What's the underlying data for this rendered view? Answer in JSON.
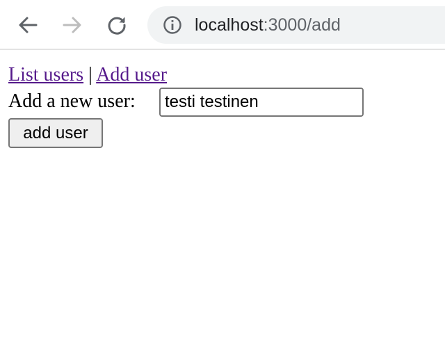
{
  "browser": {
    "url_host": "localhost",
    "url_rest": ":3000/add",
    "icons": {
      "back": "arrow-left-icon",
      "forward": "arrow-right-icon",
      "reload": "reload-icon",
      "site_info": "info-icon"
    },
    "colors": {
      "toolbar_bg": "#ffffff",
      "omnibox_bg": "#f1f3f4",
      "icon_active": "#5f6368",
      "icon_disabled": "#bdbdbd"
    }
  },
  "page": {
    "nav": {
      "list_users": "List users",
      "separator": "|",
      "add_user": "Add user"
    },
    "form": {
      "label": "Add a new user:",
      "input_value": "testi testinen",
      "submit_label": "add user"
    },
    "colors": {
      "link_visited": "#551a8b"
    }
  }
}
